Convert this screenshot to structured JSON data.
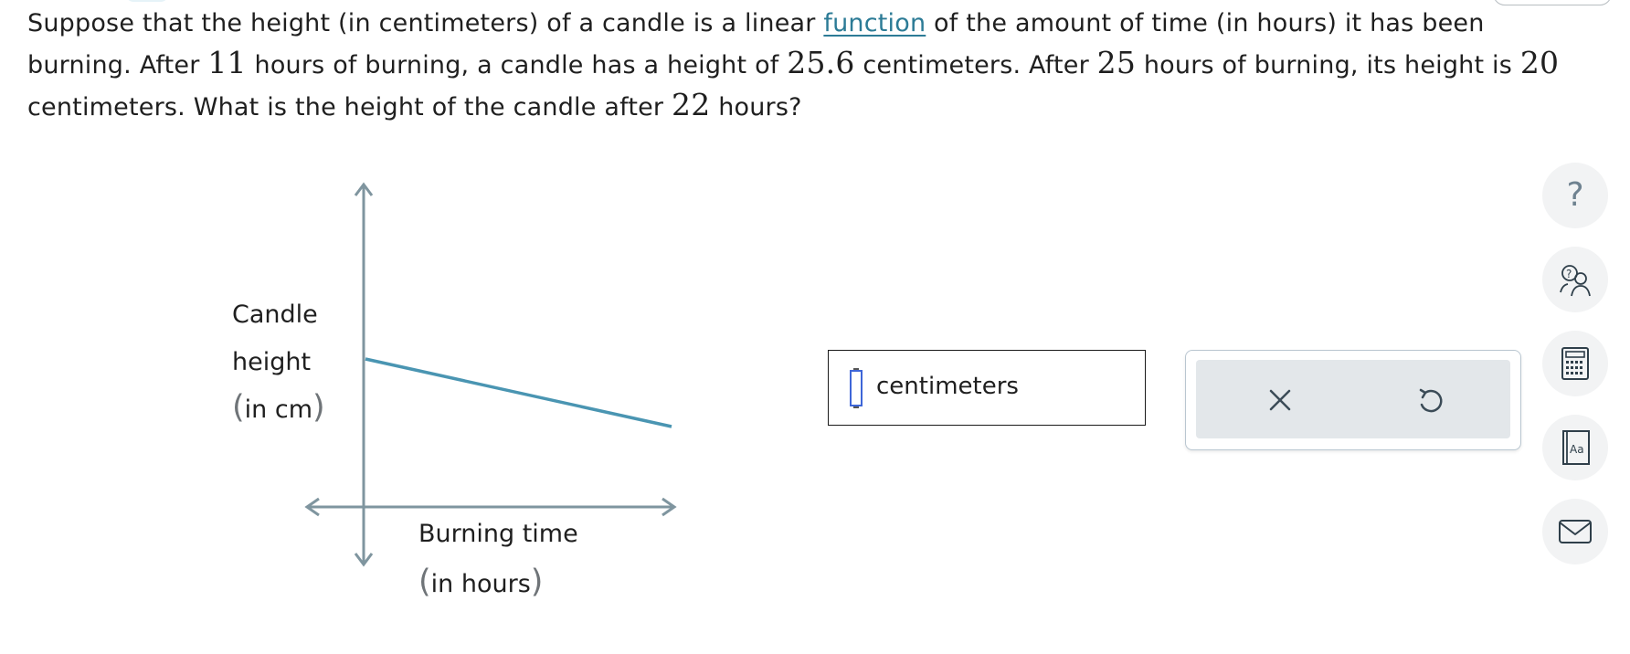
{
  "problem": {
    "part1": "Suppose that the height (in centimeters) of a candle is a linear ",
    "link": "function",
    "part2": " of the amount of time (in hours) it has been burning. After ",
    "num1": "11",
    "part3": " hours of burning, a candle has a height of ",
    "num2": "25.6",
    "part4": " centimeters. After ",
    "num3": "25",
    "part5": " hours of burning, its height is ",
    "num4": "20",
    "part6": " centimeters. What is the height of the candle after ",
    "num5": "22",
    "part7": " hours?"
  },
  "graph": {
    "y_label": {
      "line1": "Candle",
      "line2": "height",
      "line3": "in cm"
    },
    "x_label": {
      "line1": "Burning time",
      "line2": "in hours"
    }
  },
  "answer": {
    "value": "",
    "unit": "centimeters"
  },
  "actions": {
    "clear": "x-icon",
    "undo": "undo-icon"
  },
  "toolbar": {
    "help_glyph": "?"
  },
  "colors": {
    "accent": "#2c7b96",
    "line": "#4a95b2",
    "axis": "#7f959f",
    "cursor": "#3e66d8"
  }
}
